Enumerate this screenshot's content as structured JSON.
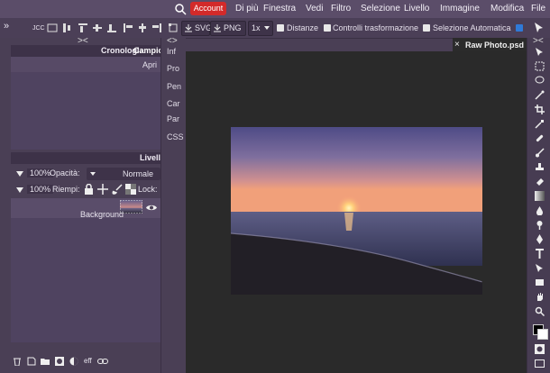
{
  "menubar": {
    "items": [
      "File",
      "Modifica",
      "Immagine",
      "Livello",
      "Selezione",
      "Filtro",
      "Vedi",
      "Finestra",
      "Di più"
    ],
    "account_label": "Account"
  },
  "options": {
    "collapse_left": "»",
    "label_jcc": "JCC",
    "zoom": "1x",
    "export_svg": "SVG",
    "export_png": "PNG",
    "distanze": "Distanze",
    "controlli": "Controlli trasformazione",
    "selezione_auto": "Selezione Automatica"
  },
  "left_panel": {
    "tabs": [
      "Cronologia",
      "Campioni"
    ],
    "apri": "Apri",
    "livelli_title": "Livelli",
    "blend_mode": "Normale",
    "opacity_label": "Opacità:",
    "opacity_value": "100%",
    "lock_label": "Lock:",
    "fill_label": "Riempi:",
    "fill_value": "100%",
    "layer_name": "Background",
    "bottom_icons": [
      "link-icon",
      "eff-label",
      "mask-icon",
      "adjust-icon",
      "folder-icon",
      "new-layer-icon",
      "delete-icon"
    ],
    "eff": "eff"
  },
  "side_tabs": [
    "Inf",
    "Pro",
    "Pen",
    "Car",
    "Par",
    "CSS"
  ],
  "document": {
    "tab_title": "Raw Photo.psd",
    "close": "×"
  },
  "colors": {
    "accent": "#d32a2a",
    "panel_bg": "#4a3f55",
    "canvas_bg": "#2a2a2a"
  }
}
